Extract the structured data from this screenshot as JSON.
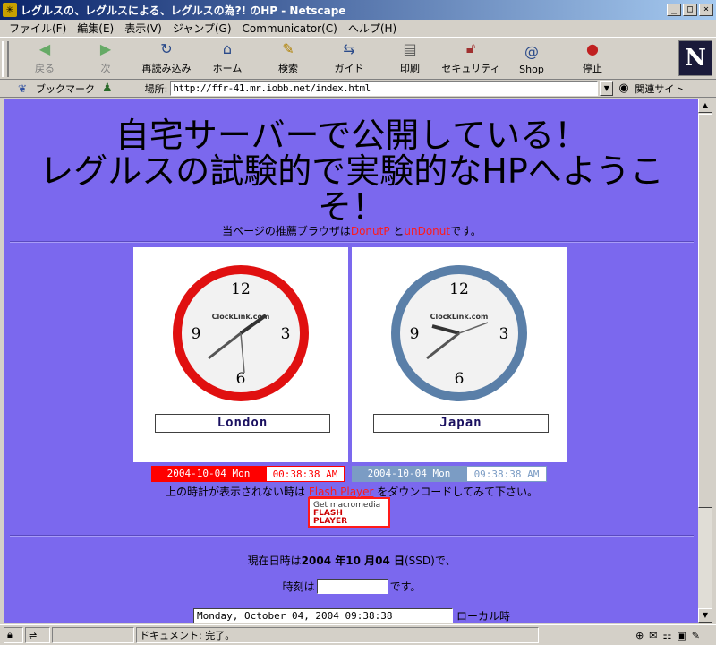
{
  "window": {
    "title": "レグルスの、レグルスによる、レグルスの為?! のHP - Netscape"
  },
  "menu": [
    "ファイル(F)",
    "編集(E)",
    "表示(V)",
    "ジャンプ(G)",
    "Communicator(C)",
    "ヘルプ(H)"
  ],
  "toolbar": {
    "back": "戻る",
    "forward": "次",
    "reload": "再読み込み",
    "home": "ホーム",
    "search": "検索",
    "guide": "ガイド",
    "print": "印刷",
    "security": "セキュリティ",
    "shop": "Shop",
    "stop": "停止"
  },
  "location": {
    "bookmarks": "ブックマーク",
    "label": "場所:",
    "url": "http://ffr-41.mr.iobb.net/index.html",
    "related": "関連サイト"
  },
  "page": {
    "heading_line1": "自宅サーバーで公開している！",
    "heading_line2": "レグルスの試験的で実験的なHPへようこ",
    "heading_line3": "そ！",
    "reco_prefix": "当ページの推薦ブラウザは",
    "reco_link1": "DonutP",
    "reco_mid": " と",
    "reco_link2": "unDonut",
    "reco_suffix": "です。",
    "clocks": [
      {
        "city": "London",
        "brand": "ClockLink.com",
        "date": "2004-10-04  Mon",
        "time": "00:38:38  AM",
        "ring_color": "#e01010",
        "date_bg": "#ff0000",
        "time_color": "#ff0000"
      },
      {
        "city": "Japan",
        "brand": "ClockLink.com",
        "date": "2004-10-04  Mon",
        "time": "09:38:38  AM",
        "ring_color": "#5a7fa8",
        "date_bg": "#7b9cc4",
        "time_color": "#7b9cc4"
      }
    ],
    "flash_prefix": "上の時計が表示されない時は ",
    "flash_link": "Flash Player",
    "flash_suffix": " をダウンロードしてみて下さい。",
    "flash_badge_line1": "Get macromedia",
    "flash_badge_line2": "FLASH",
    "flash_badge_line3": "PLAYER",
    "date_prefix": "現在日時は",
    "date_value": "2004 年10 月04 日",
    "date_suffix": "(SSD)で、",
    "time_prefix": "時刻は",
    "time_suffix": "です。",
    "local_value": "Monday, October 04, 2004 09:38:38",
    "local_label": "ローカル時"
  },
  "status": {
    "text": "ドキュメント: 完了。"
  }
}
